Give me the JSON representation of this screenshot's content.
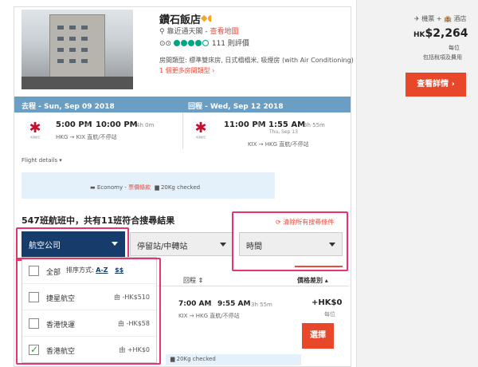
{
  "hotel": {
    "name": "鑽石飯店",
    "location_prefix": "靠近通天閣 - ",
    "map_link": "查看地圖",
    "review_count": "111 則評價",
    "room_type": "房間類型: 標準雙床房, 日式榻榻米, 吸煙房 (with Air Conditioning)",
    "more_rooms": "1 個更多房間類型 ›"
  },
  "legs": {
    "outbound_header": "去程 - Sun, Sep 09 2018",
    "return_header": "回程 - Wed, Sep 12 2018",
    "outbound": {
      "depart": "5:00 PM",
      "arrive": "10:00 PM",
      "duration": "4h 0m",
      "route": "HKG → KIX  直航/不停站"
    },
    "return": {
      "depart": "11:00 PM",
      "arrive": "1:55 AM",
      "duration": "3h 55m",
      "arrive_date": "Thu, Sep 13",
      "route": "KIX → HKG  直航/不停站"
    },
    "airline_logo_text": "香港航空"
  },
  "flight_details": "Flight details ▾",
  "fare": {
    "cabin": "Economy - ",
    "fare_rules": "票價條款",
    "baggage": "20Kg checked"
  },
  "results": {
    "title": "547班航班中，共有11班符合搜尋結果",
    "clear_all": "⟳ 清除所有搜尋條件",
    "filter_airline": "航空公司",
    "filter_stops": "停留站/中轉站",
    "filter_time": "時間",
    "col_return": "回程 ⇕",
    "col_price": "價格差別 ▴"
  },
  "airline_menu": {
    "sort_label": "排序方式: ",
    "sort_az": "A-Z",
    "sort_price": "$$",
    "items": [
      {
        "name": "全部",
        "price": "",
        "checked": false
      },
      {
        "name": "捷星航空",
        "price": "由 -HK$510",
        "checked": false
      },
      {
        "name": "香港快運",
        "price": "由 -HK$58",
        "checked": false
      },
      {
        "name": "香港航空",
        "price": "由 +HK$0",
        "checked": true
      }
    ]
  },
  "result_row": {
    "depart": "7:00 AM",
    "arrive": "9:55 AM",
    "duration": "3h 55m",
    "route": "KIX → HKG  直航/不停站",
    "price": "+HK$0",
    "per": "每位",
    "baggage": "20Kg checked",
    "select": "選擇"
  },
  "sidebar": {
    "tag": "✈ 機票 + 🏨 酒店",
    "price_currency": "HK",
    "price_value": "$2,264",
    "per_person": "每位",
    "includes": "包括稅項及費用",
    "details_button": "查看詳情 ›"
  },
  "colors": {
    "accent": "#e8472a",
    "header_blue": "#6a9ec4",
    "navy": "#153c6b",
    "highlight": "#e8336d"
  }
}
